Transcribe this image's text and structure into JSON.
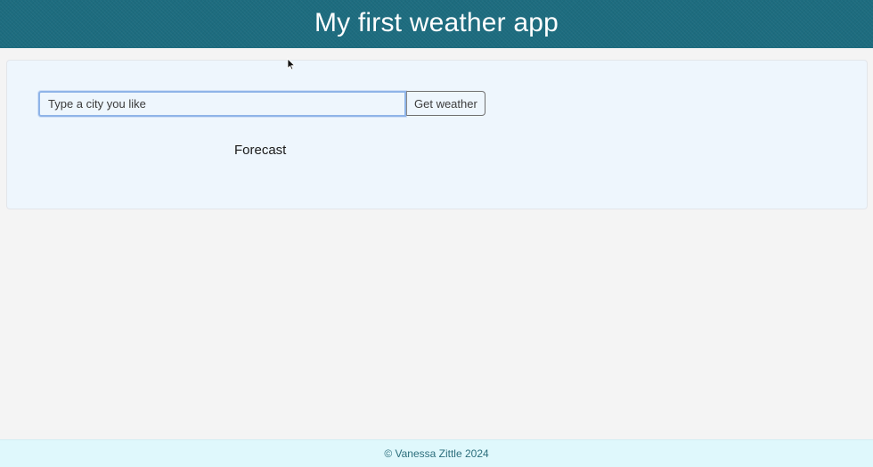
{
  "header": {
    "title": "My first weather app"
  },
  "search": {
    "placeholder": "Type a city you like",
    "value": "",
    "button_label": "Get weather"
  },
  "forecast": {
    "label": "Forecast"
  },
  "footer": {
    "text": "© Vanessa Zittle 2024"
  },
  "colors": {
    "header_bg": "#1d6c7f",
    "card_bg": "#eef6fd",
    "footer_bg": "#dff8fc",
    "input_focus_border": "#8fb4e8"
  }
}
